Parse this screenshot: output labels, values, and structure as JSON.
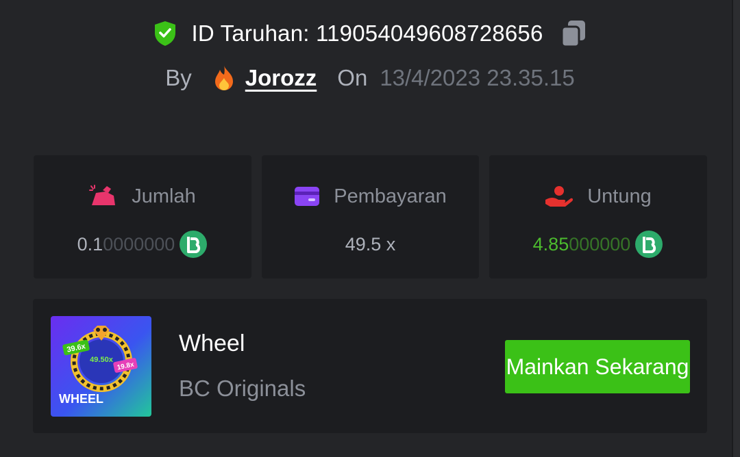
{
  "header": {
    "bet_id_text": "ID Taruhan: 119054049608728656",
    "by_label": "By",
    "username": "Jorozz",
    "on_label": "On",
    "timestamp": "13/4/2023 23.35.15"
  },
  "stats": {
    "amount": {
      "label": "Jumlah",
      "value_main": "0.1",
      "value_dim": "0000000",
      "currency_icon": "bc-coin-icon"
    },
    "payout": {
      "label": "Pembayaran",
      "value": "49.5 x"
    },
    "profit": {
      "label": "Untung",
      "value_main": "4.85",
      "value_dim": "000000",
      "currency_icon": "bc-coin-icon"
    }
  },
  "game": {
    "name": "Wheel",
    "provider": "BC Originals",
    "play_button": "Mainkan Sekarang",
    "thumb": {
      "title": "WHEEL",
      "tag_left": "39.6x",
      "tag_center": "49.50x",
      "tag_right": "19.8x"
    }
  },
  "colors": {
    "background": "#242528",
    "card": "#1c1d20",
    "accent_green": "#3bc117",
    "profit_green": "#4cbb2e",
    "coin": "#2dab6b"
  }
}
